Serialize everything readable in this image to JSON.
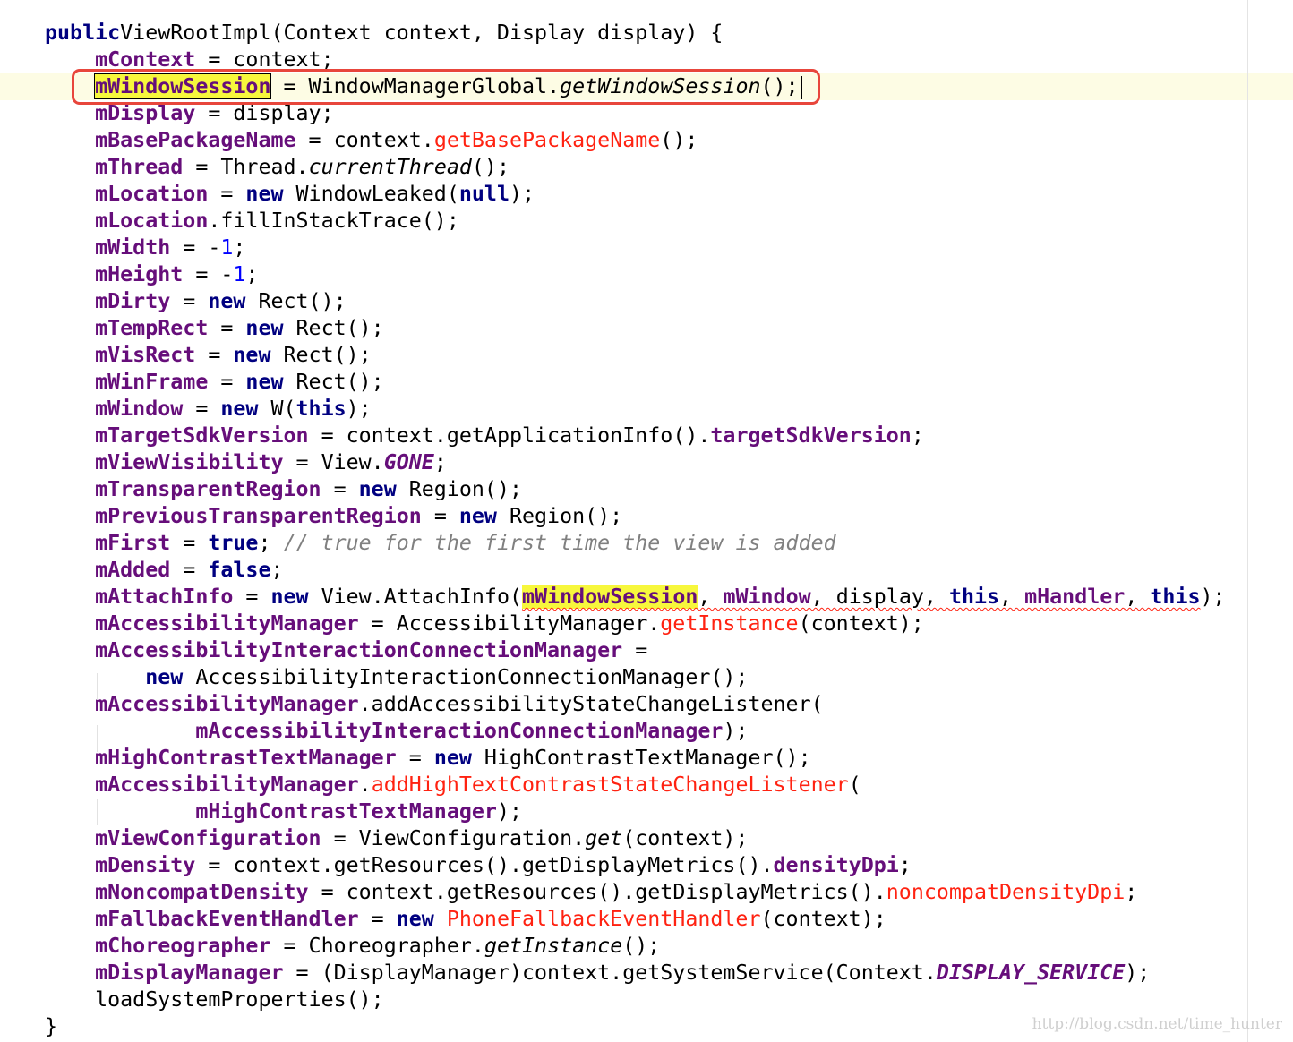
{
  "editor": {
    "lines": [
      [
        [
          "kw",
          "public"
        ],
        [
          "",
          "ViewRootImpl(Context context, Display display) {"
        ]
      ],
      [
        [
          "",
          "    "
        ],
        [
          "fld",
          "mContext"
        ],
        [
          "",
          " = context;"
        ]
      ],
      [
        [
          "",
          "    "
        ],
        [
          "fld hl caret-box",
          "mWindowSession"
        ],
        [
          "",
          " = WindowManagerGlobal."
        ],
        [
          "it",
          "getWindowSession"
        ],
        [
          "",
          "();"
        ]
      ],
      [
        [
          "",
          "    "
        ],
        [
          "fld",
          "mDisplay"
        ],
        [
          "",
          " = display;"
        ]
      ],
      [
        [
          "",
          "    "
        ],
        [
          "fld",
          "mBasePackageName"
        ],
        [
          "",
          " = context."
        ],
        [
          "err",
          "getBasePackageName"
        ],
        [
          "",
          "();"
        ]
      ],
      [
        [
          "",
          "    "
        ],
        [
          "fld",
          "mThread"
        ],
        [
          "",
          " = Thread."
        ],
        [
          "it",
          "currentThread"
        ],
        [
          "",
          "();"
        ]
      ],
      [
        [
          "",
          "    "
        ],
        [
          "fld",
          "mLocation"
        ],
        [
          "",
          " = "
        ],
        [
          "kw",
          "new"
        ],
        [
          "",
          " WindowLeaked("
        ],
        [
          "kw",
          "null"
        ],
        [
          "",
          ");"
        ]
      ],
      [
        [
          "",
          "    "
        ],
        [
          "fld",
          "mLocation"
        ],
        [
          "",
          ".fillInStackTrace();"
        ]
      ],
      [
        [
          "",
          "    "
        ],
        [
          "fld",
          "mWidth"
        ],
        [
          "",
          " = -"
        ],
        [
          "num",
          "1"
        ],
        [
          "",
          ";"
        ]
      ],
      [
        [
          "",
          "    "
        ],
        [
          "fld",
          "mHeight"
        ],
        [
          "",
          " = -"
        ],
        [
          "num",
          "1"
        ],
        [
          "",
          ";"
        ]
      ],
      [
        [
          "",
          "    "
        ],
        [
          "fld",
          "mDirty"
        ],
        [
          "",
          " = "
        ],
        [
          "kw",
          "new"
        ],
        [
          "",
          " Rect();"
        ]
      ],
      [
        [
          "",
          "    "
        ],
        [
          "fld",
          "mTempRect"
        ],
        [
          "",
          " = "
        ],
        [
          "kw",
          "new"
        ],
        [
          "",
          " Rect();"
        ]
      ],
      [
        [
          "",
          "    "
        ],
        [
          "fld",
          "mVisRect"
        ],
        [
          "",
          " = "
        ],
        [
          "kw",
          "new"
        ],
        [
          "",
          " Rect();"
        ]
      ],
      [
        [
          "",
          "    "
        ],
        [
          "fld",
          "mWinFrame"
        ],
        [
          "",
          " = "
        ],
        [
          "kw",
          "new"
        ],
        [
          "",
          " Rect();"
        ]
      ],
      [
        [
          "",
          "    "
        ],
        [
          "fld",
          "mWindow"
        ],
        [
          "",
          " = "
        ],
        [
          "kw",
          "new"
        ],
        [
          "",
          " W("
        ],
        [
          "kw",
          "this"
        ],
        [
          "",
          ");"
        ]
      ],
      [
        [
          "",
          "    "
        ],
        [
          "fld",
          "mTargetSdkVersion"
        ],
        [
          "",
          " = context.getApplicationInfo()."
        ],
        [
          "fld",
          "targetSdkVersion"
        ],
        [
          "",
          ";"
        ]
      ],
      [
        [
          "",
          "    "
        ],
        [
          "fld",
          "mViewVisibility"
        ],
        [
          "",
          " = View."
        ],
        [
          "st",
          "GONE"
        ],
        [
          "",
          ";"
        ]
      ],
      [
        [
          "",
          "    "
        ],
        [
          "fld",
          "mTransparentRegion"
        ],
        [
          "",
          " = "
        ],
        [
          "kw",
          "new"
        ],
        [
          "",
          " Region();"
        ]
      ],
      [
        [
          "",
          "    "
        ],
        [
          "fld",
          "mPreviousTransparentRegion"
        ],
        [
          "",
          " = "
        ],
        [
          "kw",
          "new"
        ],
        [
          "",
          " Region();"
        ]
      ],
      [
        [
          "",
          "    "
        ],
        [
          "fld",
          "mFirst"
        ],
        [
          "",
          " = "
        ],
        [
          "kw",
          "true"
        ],
        [
          "",
          "; "
        ],
        [
          "cm",
          "// true for the first time the view is added"
        ]
      ],
      [
        [
          "",
          "    "
        ],
        [
          "fld",
          "mAdded"
        ],
        [
          "",
          " = "
        ],
        [
          "kw",
          "false"
        ],
        [
          "",
          ";"
        ]
      ],
      [
        [
          "",
          "    "
        ],
        [
          "fld",
          "mAttachInfo"
        ],
        [
          "",
          " = "
        ],
        [
          "kw",
          "new"
        ],
        [
          "",
          " View.AttachInfo("
        ],
        [
          "fld hl squig",
          "mWindowSession"
        ],
        [
          "squig",
          ", "
        ],
        [
          "fld squig",
          "mWindow"
        ],
        [
          "squig",
          ", display, "
        ],
        [
          "kw squig",
          "this"
        ],
        [
          "squig",
          ", "
        ],
        [
          "fld squig",
          "mHandler"
        ],
        [
          "squig",
          ", "
        ],
        [
          "kw squig",
          "this"
        ],
        [
          "",
          ");"
        ]
      ],
      [
        [
          "",
          "    "
        ],
        [
          "fld",
          "mAccessibilityManager"
        ],
        [
          "",
          " = AccessibilityManager."
        ],
        [
          "err",
          "getInstance"
        ],
        [
          "",
          "(context);"
        ]
      ],
      [
        [
          "",
          "    "
        ],
        [
          "fld",
          "mAccessibilityInteractionConnectionManager"
        ],
        [
          "",
          " ="
        ]
      ],
      [
        [
          "",
          "        "
        ],
        [
          "kw",
          "new"
        ],
        [
          "",
          " AccessibilityInteractionConnectionManager();"
        ]
      ],
      [
        [
          "",
          "    "
        ],
        [
          "fld",
          "mAccessibilityManager"
        ],
        [
          "",
          ".addAccessibilityStateChangeListener("
        ]
      ],
      [
        [
          "",
          "            "
        ],
        [
          "fld",
          "mAccessibilityInteractionConnectionManager"
        ],
        [
          "",
          ");"
        ]
      ],
      [
        [
          "",
          "    "
        ],
        [
          "fld",
          "mHighContrastTextManager"
        ],
        [
          "",
          " = "
        ],
        [
          "kw",
          "new"
        ],
        [
          "",
          " HighContrastTextManager();"
        ]
      ],
      [
        [
          "",
          "    "
        ],
        [
          "fld",
          "mAccessibilityManager"
        ],
        [
          "",
          "."
        ],
        [
          "err",
          "addHighTextContrastStateChangeListener"
        ],
        [
          "",
          "("
        ]
      ],
      [
        [
          "",
          "            "
        ],
        [
          "fld",
          "mHighContrastTextManager"
        ],
        [
          "",
          ");"
        ]
      ],
      [
        [
          "",
          "    "
        ],
        [
          "fld",
          "mViewConfiguration"
        ],
        [
          "",
          " = ViewConfiguration."
        ],
        [
          "it",
          "get"
        ],
        [
          "",
          "(context);"
        ]
      ],
      [
        [
          "",
          "    "
        ],
        [
          "fld",
          "mDensity"
        ],
        [
          "",
          " = context.getResources().getDisplayMetrics()."
        ],
        [
          "fld",
          "densityDpi"
        ],
        [
          "",
          ";"
        ]
      ],
      [
        [
          "",
          "    "
        ],
        [
          "fld",
          "mNoncompatDensity"
        ],
        [
          "",
          " = context.getResources().getDisplayMetrics()."
        ],
        [
          "err",
          "noncompatDensityDpi"
        ],
        [
          "",
          ";"
        ]
      ],
      [
        [
          "",
          "    "
        ],
        [
          "fld",
          "mFallbackEventHandler"
        ],
        [
          "",
          " = "
        ],
        [
          "kw",
          "new"
        ],
        [
          "err",
          " PhoneFallbackEventHandler"
        ],
        [
          "",
          "(context);"
        ]
      ],
      [
        [
          "",
          "    "
        ],
        [
          "fld",
          "mChoreographer"
        ],
        [
          "",
          " = Choreographer."
        ],
        [
          "it",
          "getInstance"
        ],
        [
          "",
          "();"
        ]
      ],
      [
        [
          "",
          "    "
        ],
        [
          "fld",
          "mDisplayManager"
        ],
        [
          "",
          " = (DisplayManager)context.getSystemService(Context."
        ],
        [
          "st",
          "DISPLAY_SERVICE"
        ],
        [
          "",
          ");"
        ]
      ],
      [
        [
          "",
          "    "
        ],
        [
          "",
          "loadSystemProperties();"
        ]
      ],
      [
        [
          "",
          "}"
        ]
      ]
    ]
  },
  "watermark": "http://blog.csdn.net/time_hunter"
}
